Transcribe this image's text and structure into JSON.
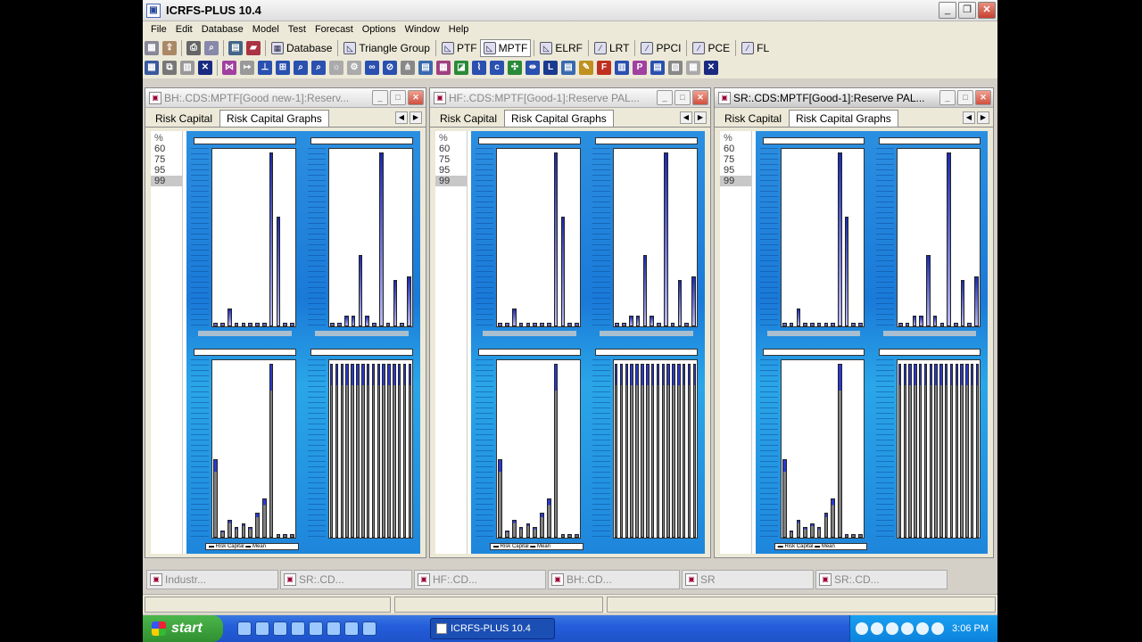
{
  "app": {
    "title": "ICRFS-PLUS 10.4"
  },
  "menu": [
    "File",
    "Edit",
    "Database",
    "Model",
    "Test",
    "Forecast",
    "Options",
    "Window",
    "Help"
  ],
  "toolbar_tabs": [
    {
      "label": "Database",
      "icon": "database-icon"
    },
    {
      "label": "Triangle Group",
      "icon": "triangle-icon"
    },
    {
      "label": "PTF",
      "icon": "ptf-icon"
    },
    {
      "label": "MPTF",
      "icon": "mptf-icon",
      "active": true
    },
    {
      "label": "ELRF",
      "icon": "elrf-icon"
    },
    {
      "label": "LRT",
      "icon": "lrt-icon"
    },
    {
      "label": "PPCI",
      "icon": "ppci-icon"
    },
    {
      "label": "PCE",
      "icon": "pce-icon"
    },
    {
      "label": "FL",
      "icon": "fl-icon"
    }
  ],
  "windows": [
    {
      "title": "BH:.CDS:MPTF[Good new-1]:Reserv...",
      "tabs": [
        "Risk Capital",
        "Risk Capital Graphs"
      ]
    },
    {
      "title": "HF:.CDS:MPTF[Good-1]:Reserve PAL...",
      "tabs": [
        "Risk Capital",
        "Risk Capital Graphs"
      ]
    },
    {
      "title": "SR:.CDS:MPTF[Good-1]:Reserve PAL...",
      "tabs": [
        "Risk Capital",
        "Risk Capital Graphs"
      ]
    }
  ],
  "percentiles": {
    "header": "%",
    "values": [
      "60",
      "75",
      "95",
      "99"
    ],
    "selected": "99"
  },
  "graph_legend": {
    "series_a": "Risk Capital",
    "series_b": "Mean"
  },
  "minimized_windows": [
    "Industr...",
    "SR:.CD...",
    "HF:.CD...",
    "BH:.CD...",
    "SR",
    "SR:.CD..."
  ],
  "taskbar": {
    "start": "start",
    "task": "ICRFS-PLUS 10.4",
    "clock": "3:06 PM"
  }
}
